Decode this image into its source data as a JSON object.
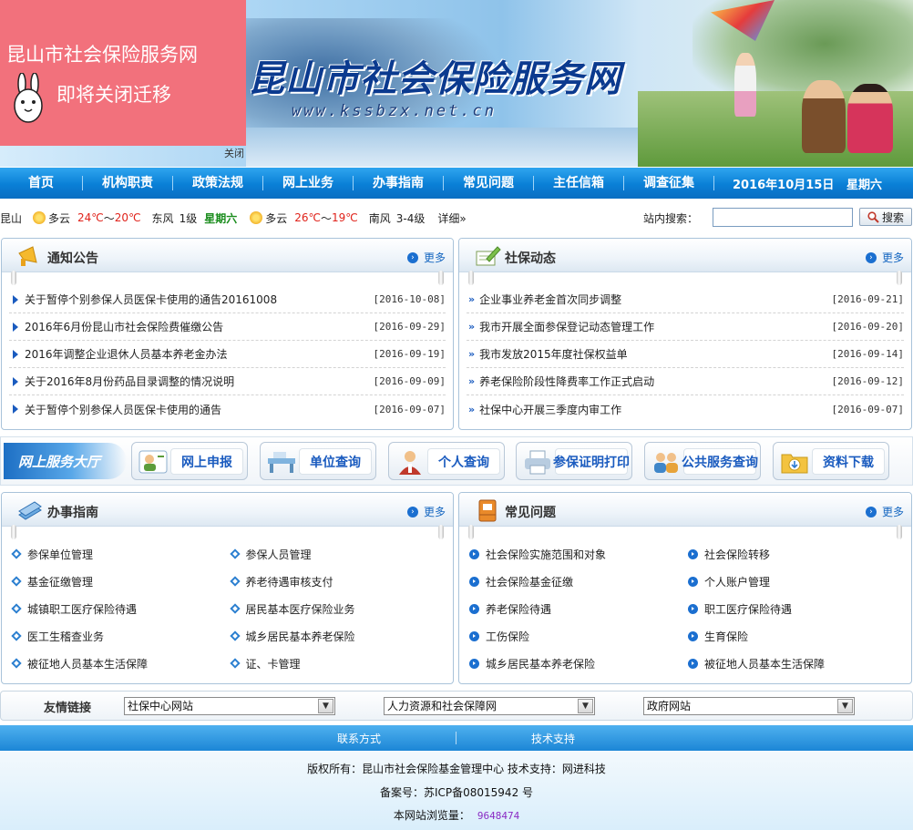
{
  "banner": {
    "site_title": "昆山市社会保险服务网",
    "site_url": "www.kssbzx.net.cn",
    "notice_line1": "昆山市社会保险服务网",
    "notice_line2": "即将关闭迁移",
    "notice_close": "关闭"
  },
  "nav": {
    "items": [
      "首页",
      "机构职责",
      "政策法规",
      "网上业务",
      "办事指南",
      "常见问题",
      "主任信箱",
      "调查征集"
    ],
    "date": "2016年10月15日",
    "weekday": "星期六"
  },
  "weather": {
    "city": "昆山",
    "today": {
      "cond": "多云",
      "temp_hi": "24℃",
      "temp_sep": "～",
      "temp_lo": "20℃",
      "wind": "东风",
      "level": "1级",
      "week": "星期六"
    },
    "tomorrow": {
      "cond": "多云",
      "temp_hi": "26℃",
      "temp_sep": "～",
      "temp_lo": "19℃",
      "wind": "南风",
      "level": "3-4级"
    },
    "detail_link": "详细»"
  },
  "search": {
    "label": "站内搜索：",
    "value": "",
    "button": "搜索"
  },
  "notices": {
    "title": "通知公告",
    "more": "更多",
    "items": [
      {
        "title": "关于暂停个别参保人员医保卡使用的通告20161008",
        "date": "[2016-10-08]"
      },
      {
        "title": "2016年6月份昆山市社会保险费催缴公告",
        "date": "[2016-09-29]"
      },
      {
        "title": "2016年调整企业退休人员基本养老金办法",
        "date": "[2016-09-19]"
      },
      {
        "title": "关于2016年8月份药品目录调整的情况说明",
        "date": "[2016-09-09]"
      },
      {
        "title": "关于暂停个别参保人员医保卡使用的通告",
        "date": "[2016-09-07]"
      }
    ]
  },
  "news": {
    "title": "社保动态",
    "more": "更多",
    "items": [
      {
        "title": "企业事业养老金首次同步调整",
        "date": "[2016-09-21]"
      },
      {
        "title": "我市开展全面参保登记动态管理工作",
        "date": "[2016-09-20]"
      },
      {
        "title": "我市发放2015年度社保权益单",
        "date": "[2016-09-14]"
      },
      {
        "title": "养老保险阶段性降费率工作正式启动",
        "date": "[2016-09-12]"
      },
      {
        "title": "社保中心开展三季度内审工作",
        "date": "[2016-09-07]"
      }
    ]
  },
  "services": {
    "label": "网上服务大厅",
    "buttons": [
      "网上申报",
      "单位查询",
      "个人查询",
      "参保证明打印",
      "公共服务查询",
      "资料下载"
    ]
  },
  "guide": {
    "title": "办事指南",
    "more": "更多",
    "items": [
      "参保单位管理",
      "参保人员管理",
      "基金征缴管理",
      "养老待遇审核支付",
      "城镇职工医疗保险待遇",
      "居民基本医疗保险业务",
      "医工生稽查业务",
      "城乡居民基本养老保险",
      "被征地人员基本生活保障",
      "证、卡管理"
    ]
  },
  "faq": {
    "title": "常见问题",
    "more": "更多",
    "items": [
      "社会保险实施范围和对象",
      "社会保险转移",
      "社会保险基金征缴",
      "个人账户管理",
      "养老保险待遇",
      "职工医疗保险待遇",
      "工伤保险",
      "生育保险",
      "城乡居民基本养老保险",
      "被征地人员基本生活保障"
    ]
  },
  "links": {
    "label": "友情链接",
    "selects": [
      "社保中心网站",
      "人力资源和社会保障网",
      "政府网站"
    ]
  },
  "footer": {
    "contact": "联系方式",
    "tech": "技术支持",
    "copyright": "版权所有：昆山市社会保险基金管理中心  技术支持：网进科技",
    "icp": "备案号：苏ICP备08015942 号",
    "visits_label": "本网站浏览量：",
    "visits_count": "9648474"
  }
}
